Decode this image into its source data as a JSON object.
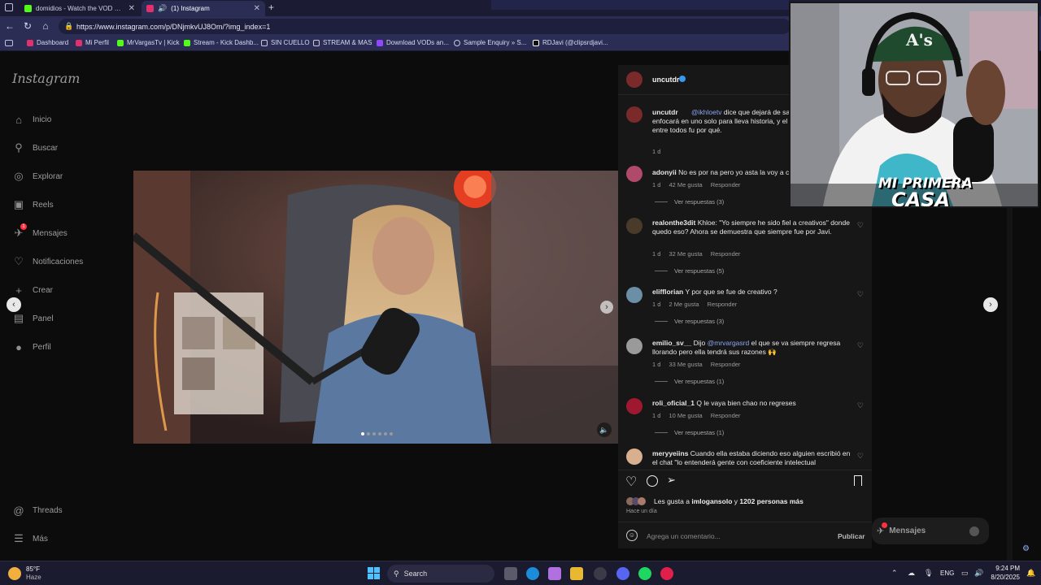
{
  "browser": {
    "tabs": [
      {
        "label": "domidios - Watch the VOD on Kick",
        "color": "#53fc18"
      },
      {
        "label": "(1) Instagram",
        "color": "#e1306c"
      }
    ],
    "new_tab": "+",
    "url": "https://www.instagram.com/p/DNjmkvUJ8Om/?img_index=1",
    "bookmarks": [
      {
        "label": "Dashboard",
        "color": "#e1306c"
      },
      {
        "label": "Mi Perfil",
        "color": "#e1306c"
      },
      {
        "label": "MrVargasTv | Kick",
        "color": "#53fc18"
      },
      {
        "label": "Stream - Kick Dashb...",
        "color": "#53fc18"
      },
      {
        "label": "SIN CUELLO",
        "color": "#c9c9d9"
      },
      {
        "label": "STREAM & MAS",
        "color": "#c9c9d9"
      },
      {
        "label": "Download VODs an...",
        "color": "#9146ff"
      },
      {
        "label": "Sample Enquiry » S...",
        "color": "#c9c9d9"
      },
      {
        "label": "RDJavi (@clipsrdjavi...",
        "color": "#ffffff"
      }
    ]
  },
  "instagram": {
    "logo": "Instagram",
    "nav": [
      {
        "label": "Inicio",
        "icon": "home-icon",
        "glyph": "⌂"
      },
      {
        "label": "Buscar",
        "icon": "search-icon",
        "glyph": "⚲"
      },
      {
        "label": "Explorar",
        "icon": "compass-icon",
        "glyph": "◎"
      },
      {
        "label": "Reels",
        "icon": "reels-icon",
        "glyph": "▣"
      },
      {
        "label": "Mensajes",
        "icon": "messenger-icon",
        "glyph": "✈"
      },
      {
        "label": "Notificaciones",
        "icon": "heart-icon",
        "glyph": "♡"
      },
      {
        "label": "Crear",
        "icon": "plus-icon",
        "glyph": "+"
      },
      {
        "label": "Panel",
        "icon": "dashboard-icon",
        "glyph": "▤"
      },
      {
        "label": "Perfil",
        "icon": "profile-icon",
        "glyph": "●"
      }
    ],
    "nav_bottom": [
      {
        "label": "Threads",
        "icon": "threads-icon",
        "glyph": "@"
      },
      {
        "label": "Más",
        "icon": "menu-icon",
        "glyph": "☰"
      }
    ],
    "messages_badge": "1",
    "post": {
      "author": "uncutdr",
      "caption_author": "uncutdr",
      "caption_mention": "@ikhloetv",
      "caption_text": "dice que dejará de sal servidor y se enfocará en uno solo para lleva historia, y el server que eligió entre todos fu por qué.",
      "caption_time": "1 d",
      "comments": [
        {
          "user": "adonyii",
          "text": "No es por na pero yo asta la voy a c",
          "time": "1 d",
          "likes": "42 Me gusta",
          "reply": "Responder",
          "replies": "Ver respuestas (3)",
          "avatar": "#b04a6a"
        },
        {
          "user": "realonthe3dit",
          "text": "Khloe: \"Yo siempre he sido fiel a creativos\" donde quedo eso? Ahora se demuestra que siempre fue por Javi.",
          "time": "1 d",
          "likes": "32 Me gusta",
          "reply": "Responder",
          "replies": "Ver respuestas (5)",
          "avatar": "#4a3a2a"
        },
        {
          "user": "elifflorian",
          "text": "Y por que se fue de creativo ?",
          "time": "1 d",
          "likes": "2 Me gusta",
          "reply": "Responder",
          "replies": "Ver respuestas (3)",
          "avatar": "#6c8fa8"
        },
        {
          "user": "emilio_sv__",
          "text_pre": "Dijo",
          "mention": "@mrvargasrd",
          "text": "el que se va siempre regresa llorando pero ella tendrá sus razones 🙌",
          "time": "1 d",
          "likes": "33 Me gusta",
          "reply": "Responder",
          "replies": "Ver respuestas (1)",
          "avatar": "#9a9a9a"
        },
        {
          "user": "roli_oficial_1",
          "text": "Q le vaya bien chao no regreses",
          "time": "1 d",
          "likes": "10 Me gusta",
          "reply": "Responder",
          "replies": "Ver respuestas (1)",
          "avatar": "#a01830"
        },
        {
          "user": "meryyeiins",
          "text": "Cuando ella estaba diciendo eso alguien escribió en el chat \"lo entenderá gente con coeficiente intelectual",
          "avatar": "#d8b090"
        }
      ],
      "likes_prefix": "Les gusta a",
      "likes_user": "imlogansolo",
      "likes_and": "y",
      "likes_count": "1202 personas más",
      "posted": "Hace un día",
      "comment_placeholder": "Agrega un comentario...",
      "publish": "Publicar"
    },
    "messages_box": "Mensajes"
  },
  "webcam": {
    "overlay_line1": "MI PRIMERA",
    "overlay_line2": "CASA"
  },
  "taskbar": {
    "weather_temp": "85°F",
    "weather_desc": "Haze",
    "search": "Search",
    "lang": "ENG",
    "time": "9:24 PM",
    "date": "8/20/2025"
  }
}
